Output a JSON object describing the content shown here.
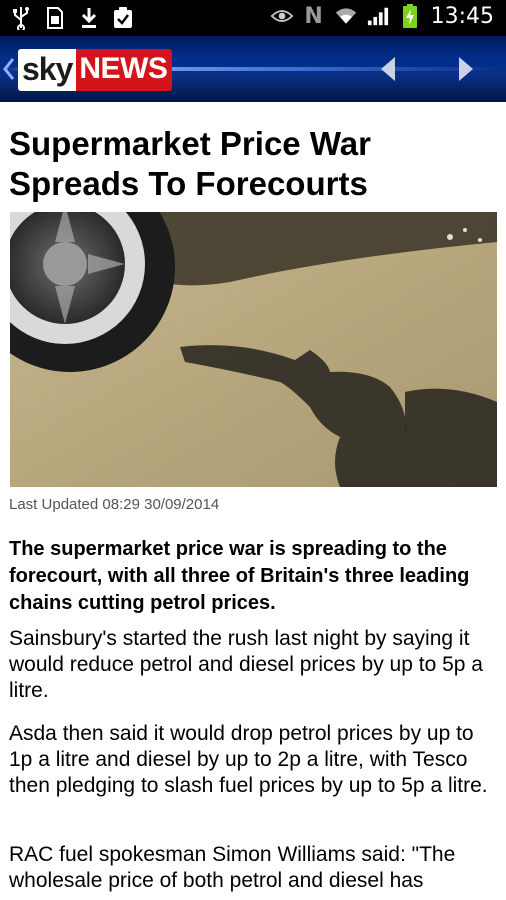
{
  "status_bar": {
    "time": "13:45",
    "network_letter": "N",
    "left_icons": [
      "usb-icon",
      "sd-card-icon",
      "download-icon",
      "clipboard-check-icon"
    ],
    "right_icons": [
      "eye-icon",
      "nfc-icon",
      "wifi-icon",
      "signal-icon",
      "battery-charging-icon"
    ]
  },
  "app_bar": {
    "logo_sky": "sky",
    "logo_news": "NEWS",
    "brand_colors": {
      "bar": "#002e8a",
      "news_red": "#d4131a"
    }
  },
  "article": {
    "headline": "Supermarket Price War Spreads To Forecourts",
    "image_alt": "Shadow of a fuel pump nozzle on a forecourt next to a car wheel",
    "last_updated": "Last Updated 08:29 30/09/2014",
    "lead": "The supermarket price war is spreading to the forecourt, with all three of Britain's three leading chains cutting petrol prices.",
    "paragraphs": [
      "Sainsbury's started the rush last night by saying it would reduce petrol and diesel prices by up to 5p a litre.",
      "Asda then said it would drop petrol prices by up to 1p a litre and diesel by up to 2p a litre, with Tesco then pledging to slash fuel prices by up to 5p a litre.",
      "RAC fuel spokesman Simon Williams said: \"The wholesale price of both petrol and diesel has"
    ]
  }
}
